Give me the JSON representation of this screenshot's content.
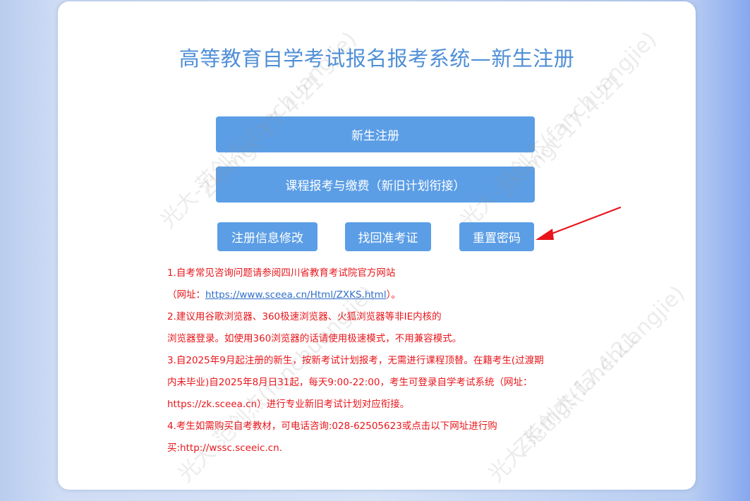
{
  "page": {
    "title": "高等教育自学考试报名报考系统—新生注册"
  },
  "buttons": {
    "register": "新生注册",
    "course_payment": "课程报考与缴费（新旧计划衔接）",
    "modify_info": "注册信息修改",
    "find_ticket": "找回准考证",
    "reset_password": "重置密码"
  },
  "notes": {
    "l1": "1.自考常见咨询问题请参阅四川省教育考试院官方网站",
    "l2_prefix": "（网址：",
    "l2_link": "https://www.sceea.cn/Html/ZXKS.html",
    "l2_suffix": "）。",
    "l3": "2.建议用谷歌浏览器、360极速浏览器、火狐浏览器等非IE内核的",
    "l4": "浏览器登录。如使用360浏览器的话请使用极速模式，不用兼容模式。",
    "l5": "3.自2025年9月起注册的新生，按新考试计划报考，无需进行课程顶替。在籍考生(过渡期",
    "l6": "内未毕业)自2025年8月日31起，每天9:00-22:00，考生可登录自学考试系统（网址：",
    "l7": "https://zk.sceea.cn）进行专业新旧考试计划对应衔接。",
    "l8": "4.考生如需购买自考教材，可电话咨询:028-62505623或点击以下网址进行购",
    "l9": "买:http://wssc.sceeic.cn."
  },
  "watermark": {
    "name": "光大-范创杰(fanchuangjie)",
    "code": "ZK-mgt-17.4.21"
  },
  "colors": {
    "accent": "#5b9ee6",
    "title": "#4f8fd6",
    "notice": "#e8161b",
    "arrow": "#e8161b"
  },
  "icons": {
    "annotation": "arrow-pointer-icon"
  }
}
